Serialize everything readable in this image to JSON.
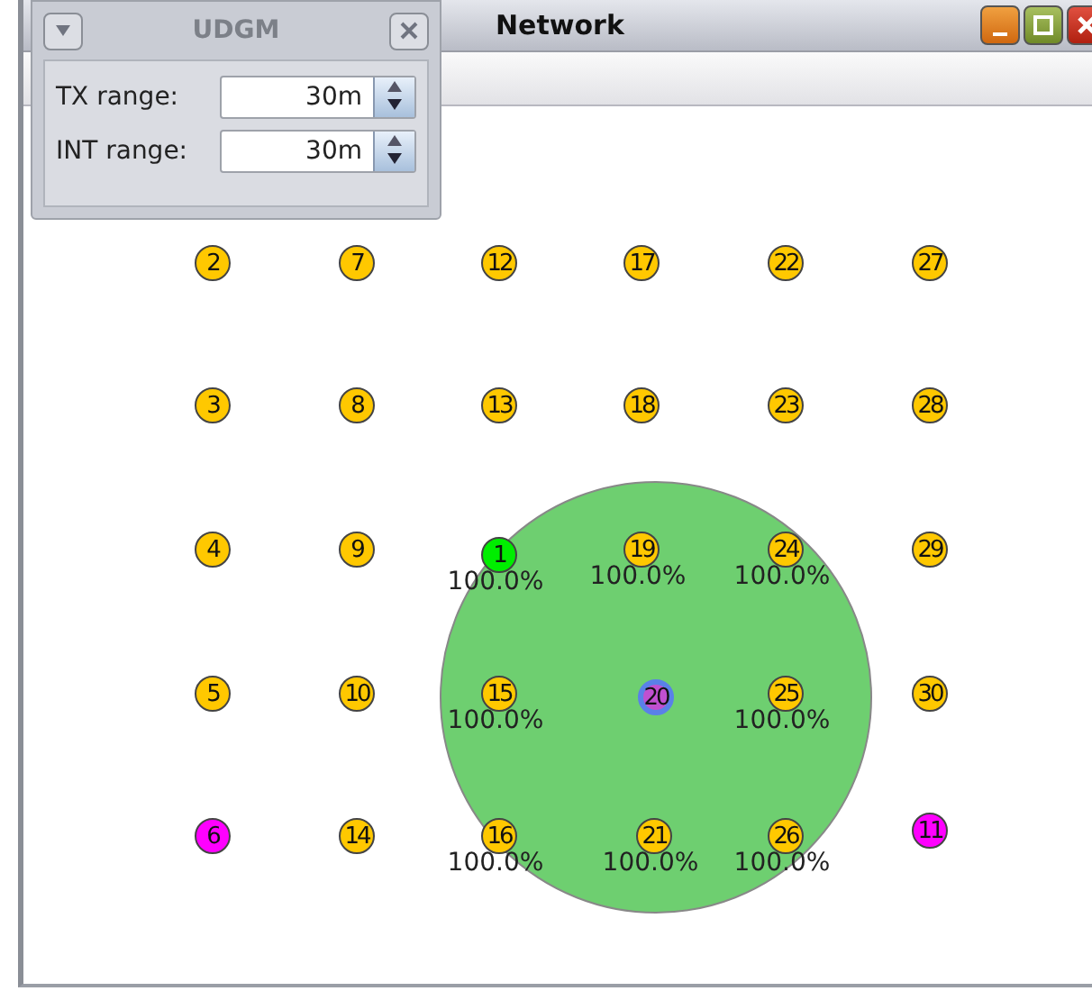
{
  "window": {
    "title": "Network"
  },
  "udgm": {
    "title": "UDGM",
    "fields": [
      {
        "label": "TX range:",
        "value": "30m"
      },
      {
        "label": "INT range:",
        "value": "30m"
      }
    ]
  },
  "nodes": [
    {
      "id": "2",
      "color": "#ffc800",
      "selected": false
    },
    {
      "id": "3",
      "color": "#ffc800",
      "selected": false
    },
    {
      "id": "4",
      "color": "#ffc800",
      "selected": false
    },
    {
      "id": "5",
      "color": "#ffc800",
      "selected": false
    },
    {
      "id": "6",
      "color": "#ff00ff",
      "selected": false
    },
    {
      "id": "7",
      "color": "#ffc800",
      "selected": false
    },
    {
      "id": "8",
      "color": "#ffc800",
      "selected": false
    },
    {
      "id": "9",
      "color": "#ffc800",
      "selected": false
    },
    {
      "id": "10",
      "color": "#ffc800",
      "selected": false
    },
    {
      "id": "14",
      "color": "#ffc800",
      "selected": false
    },
    {
      "id": "12",
      "color": "#ffc800",
      "selected": false
    },
    {
      "id": "13",
      "color": "#ffc800",
      "selected": false
    },
    {
      "id": "1",
      "color": "#00ee00",
      "selected": false,
      "reception": "100.0%"
    },
    {
      "id": "15",
      "color": "#ffc800",
      "selected": false,
      "reception": "100.0%"
    },
    {
      "id": "16",
      "color": "#ffc800",
      "selected": false,
      "reception": "100.0%"
    },
    {
      "id": "17",
      "color": "#ffc800",
      "selected": false
    },
    {
      "id": "18",
      "color": "#ffc800",
      "selected": false
    },
    {
      "id": "19",
      "color": "#ffc800",
      "selected": false,
      "reception": "100.0%"
    },
    {
      "id": "20",
      "color": "#c050d0",
      "selected": true
    },
    {
      "id": "21",
      "color": "#ffc800",
      "selected": false,
      "reception": "100.0%"
    },
    {
      "id": "22",
      "color": "#ffc800",
      "selected": false
    },
    {
      "id": "23",
      "color": "#ffc800",
      "selected": false
    },
    {
      "id": "24",
      "color": "#ffc800",
      "selected": false,
      "reception": "100.0%"
    },
    {
      "id": "25",
      "color": "#ffc800",
      "selected": false,
      "reception": "100.0%"
    },
    {
      "id": "26",
      "color": "#ffc800",
      "selected": false,
      "reception": "100.0%"
    },
    {
      "id": "27",
      "color": "#ffc800",
      "selected": false
    },
    {
      "id": "28",
      "color": "#ffc800",
      "selected": false
    },
    {
      "id": "29",
      "color": "#ffc800",
      "selected": false
    },
    {
      "id": "30",
      "color": "#ffc800",
      "selected": false
    },
    {
      "id": "11",
      "color": "#ff00ff",
      "selected": false
    }
  ]
}
